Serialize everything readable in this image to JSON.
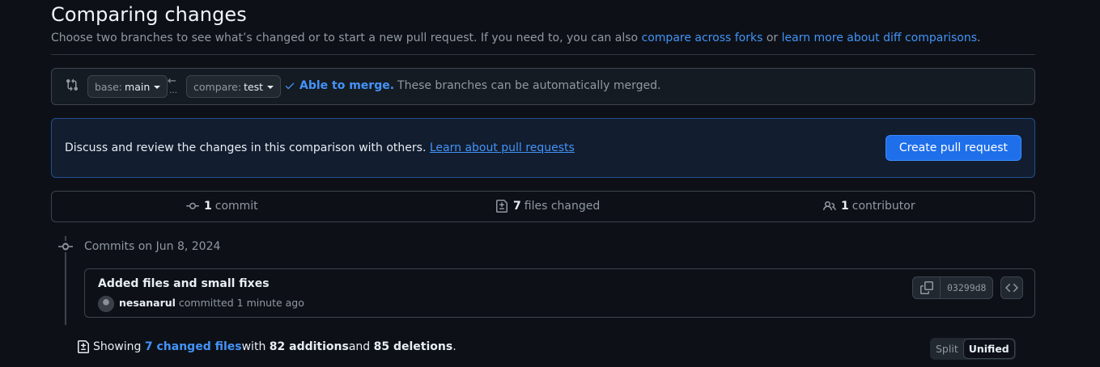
{
  "header": {
    "title": "Comparing changes",
    "subhead_prefix": "Choose two branches to see what’s changed or to start a new pull request. If you need to, you can also ",
    "link_forks": "compare across forks",
    "subhead_or": " or ",
    "link_learn_diff": "learn more about diff comparisons",
    "subhead_suffix": "."
  },
  "range": {
    "base_label": "base:",
    "base_branch": "main",
    "compare_label": "compare:",
    "compare_branch": "test",
    "arrow": "←",
    "dots": "…",
    "merge_ok": "Able to merge.",
    "merge_text": "These branches can be automatically merged."
  },
  "flash": {
    "text": "Discuss and review the changes in this comparison with others. ",
    "link": "Learn about pull requests",
    "button": "Create pull request"
  },
  "summary": {
    "commits_count": "1",
    "commits_label": "commit",
    "files_count": "7",
    "files_label": "files changed",
    "contrib_count": "1",
    "contrib_label": "contributor"
  },
  "commits": {
    "date_heading": "Commits on Jun 8, 2024",
    "items": [
      {
        "title": "Added files and small fixes",
        "author": "nesanarul",
        "action": " committed 1 minute ago",
        "sha": "03299d8"
      }
    ]
  },
  "toc": {
    "prefix": "Showing ",
    "files_link": "7 changed files",
    "with": " with ",
    "additions": "82 additions",
    "and": " and ",
    "deletions": "85 deletions",
    "suffix": ".",
    "split": "Split",
    "unified": "Unified"
  },
  "colors": {
    "background": "#0d1117",
    "accent": "#4493f8",
    "button_primary": "#1f6feb",
    "border": "#3d444d"
  }
}
